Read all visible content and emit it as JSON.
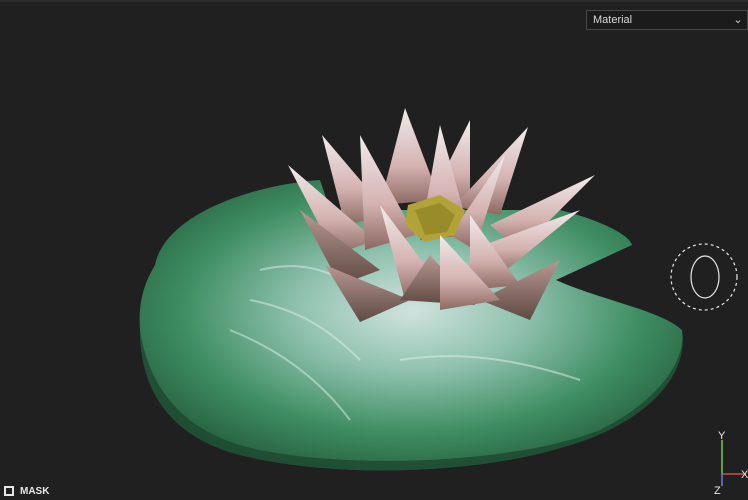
{
  "view": {
    "shading_mode": "Material",
    "mask_label": "MASK",
    "axis_labels": {
      "x": "X",
      "y": "Y",
      "z": "Z"
    },
    "colors": {
      "background": "#202020",
      "pad": "#2f7a52",
      "petal": "#d9c6c3",
      "center": "#b2a238"
    }
  }
}
